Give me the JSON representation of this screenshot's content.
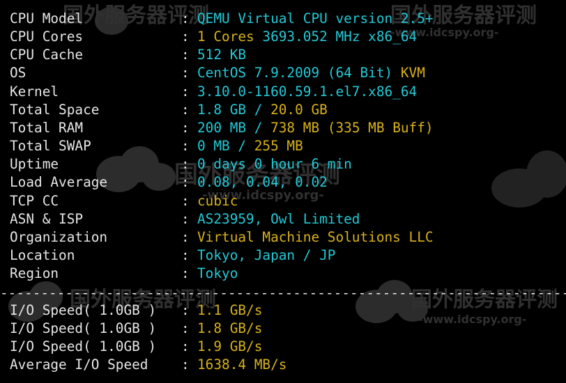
{
  "terminal": {
    "rows": [
      {
        "label": "CPU Model",
        "segments": [
          {
            "text": "QEMU Virtual CPU version 2.5+",
            "color": "cyan"
          }
        ]
      },
      {
        "label": "CPU Cores",
        "segments": [
          {
            "text": "1 Cores ",
            "color": "yellow"
          },
          {
            "text": "3693.052 MHz x86_64",
            "color": "cyan"
          }
        ]
      },
      {
        "label": "CPU Cache",
        "segments": [
          {
            "text": "512 KB",
            "color": "cyan"
          }
        ]
      },
      {
        "label": "OS",
        "segments": [
          {
            "text": "CentOS 7.9.2009 (64 Bit) ",
            "color": "cyan"
          },
          {
            "text": "KVM",
            "color": "yellow"
          }
        ]
      },
      {
        "label": "Kernel",
        "segments": [
          {
            "text": "3.10.0-1160.59.1.el7.x86_64",
            "color": "cyan"
          }
        ]
      },
      {
        "label": "Total Space",
        "segments": [
          {
            "text": "1.8 GB / ",
            "color": "cyan"
          },
          {
            "text": "20.0 GB",
            "color": "yellow"
          }
        ]
      },
      {
        "label": "Total RAM",
        "segments": [
          {
            "text": "200 MB / ",
            "color": "cyan"
          },
          {
            "text": "738 MB (335 MB Buff)",
            "color": "yellow"
          }
        ]
      },
      {
        "label": "Total SWAP",
        "segments": [
          {
            "text": "0 MB / ",
            "color": "cyan"
          },
          {
            "text": "255 MB",
            "color": "yellow"
          }
        ]
      },
      {
        "label": "Uptime",
        "segments": [
          {
            "text": "0 days 0 hour 6 min",
            "color": "cyan"
          }
        ]
      },
      {
        "label": "Load Average",
        "segments": [
          {
            "text": "0.08, 0.04, 0.02",
            "color": "cyan"
          }
        ]
      },
      {
        "label": "TCP CC",
        "segments": [
          {
            "text": "cubic",
            "color": "yellow"
          }
        ]
      },
      {
        "label": "ASN & ISP",
        "segments": [
          {
            "text": "AS23959, Owl Limited",
            "color": "cyan"
          }
        ]
      },
      {
        "label": "Organization",
        "segments": [
          {
            "text": "Virtual Machine Solutions LLC",
            "color": "yellow"
          }
        ]
      },
      {
        "label": "Location",
        "segments": [
          {
            "text": "Tokyo, Japan / JP",
            "color": "cyan"
          }
        ]
      },
      {
        "label": "Region",
        "segments": [
          {
            "text": "Tokyo",
            "color": "cyan"
          }
        ]
      }
    ],
    "colon": ":",
    "divider": "----------------------------------------------------------------------",
    "io_rows": [
      {
        "label": "I/O Speed( 1.0GB )",
        "segments": [
          {
            "text": "1.1 GB/s",
            "color": "yellow"
          }
        ]
      },
      {
        "label": "I/O Speed( 1.0GB )",
        "segments": [
          {
            "text": "1.8 GB/s",
            "color": "yellow"
          }
        ]
      },
      {
        "label": "I/O Speed( 1.0GB )",
        "segments": [
          {
            "text": "1.9 GB/s",
            "color": "yellow"
          }
        ]
      },
      {
        "label": "Average I/O Speed",
        "segments": [
          {
            "text": "1638.4 MB/s",
            "color": "yellow"
          }
        ]
      }
    ]
  },
  "watermark": {
    "title": "国外服务器评测",
    "url": "-www.idcspy.org-"
  },
  "colors": {
    "background": "#000000",
    "label": "#e6e6e6",
    "cyan": "#22c9d6",
    "yellow": "#d8b21a"
  }
}
